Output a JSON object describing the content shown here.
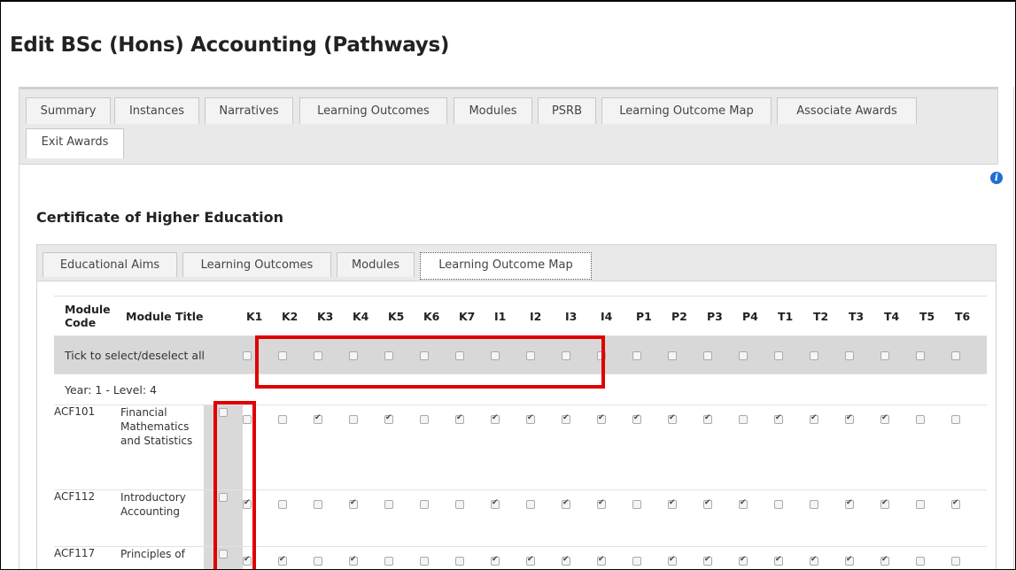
{
  "page_title": "Edit BSc (Hons) Accounting (Pathways)",
  "outer_tabs": [
    "Summary",
    "Instances",
    "Narratives",
    "Learning Outcomes",
    "Modules",
    "PSRB",
    "Learning Outcome Map",
    "Associate Awards",
    "Exit Awards"
  ],
  "outer_active_tab": "Exit Awards",
  "section_title": "Certificate of Higher Education",
  "inner_tabs": [
    "Educational Aims",
    "Learning Outcomes",
    "Modules",
    "Learning Outcome Map"
  ],
  "inner_active_tab": "Learning Outcome Map",
  "table": {
    "header_code": "Module Code",
    "header_title": "Module Title",
    "outcomes": [
      "K1",
      "K2",
      "K3",
      "K4",
      "K5",
      "K6",
      "K7",
      "I1",
      "I2",
      "I3",
      "I4",
      "P1",
      "P2",
      "P3",
      "P4",
      "T1",
      "T2",
      "T3",
      "T4",
      "T5",
      "T6"
    ],
    "select_all_label": "Tick to select/deselect all",
    "year_label": "Year: 1 - Level: 4",
    "rows": [
      {
        "code": "ACF101",
        "title": "Financial Mathematics and Statistics",
        "checks": [
          0,
          0,
          1,
          0,
          1,
          0,
          1,
          1,
          1,
          1,
          1,
          1,
          1,
          1,
          0,
          1,
          1,
          1,
          1,
          0,
          0
        ]
      },
      {
        "code": "ACF112",
        "title": "Introductory Accounting",
        "checks": [
          1,
          0,
          0,
          1,
          0,
          0,
          0,
          1,
          0,
          1,
          1,
          0,
          1,
          1,
          1,
          0,
          0,
          1,
          1,
          0,
          1
        ]
      },
      {
        "code": "ACF117",
        "title": "Principles of",
        "checks": [
          1,
          1,
          0,
          1,
          0,
          0,
          0,
          1,
          1,
          1,
          1,
          0,
          1,
          1,
          1,
          1,
          1,
          1,
          1,
          0,
          0
        ]
      }
    ]
  },
  "info_icon": "info-icon",
  "highlight_color": "#e00000"
}
